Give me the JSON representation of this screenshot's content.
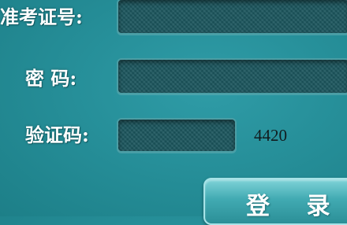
{
  "form": {
    "exam_id_label": "准考证号:",
    "password_label": "密 码:",
    "captcha_label": "验证码:",
    "exam_id_value": "",
    "password_value": "",
    "captcha_value": "",
    "captcha_code": "4420",
    "login_label": "登 录"
  }
}
